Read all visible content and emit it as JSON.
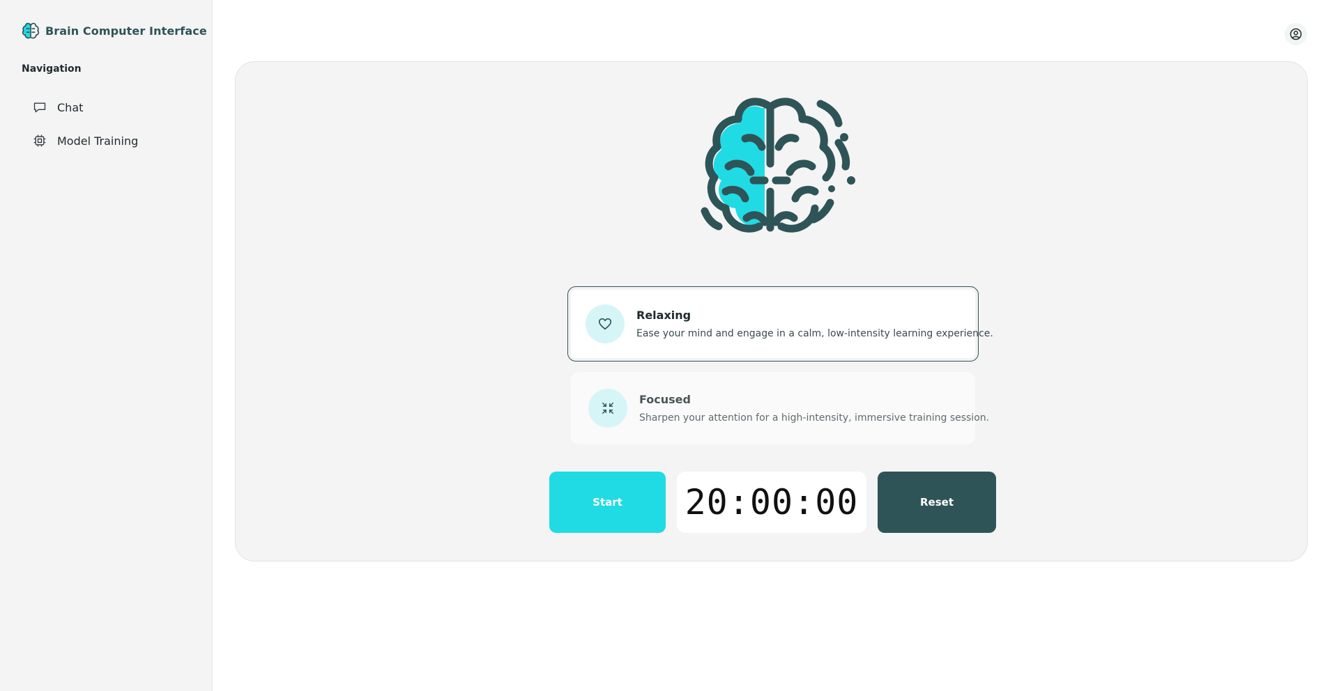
{
  "app": {
    "title": "Brain Computer Interface",
    "logo_icon": "brain-icon"
  },
  "sidebar": {
    "heading": "Navigation",
    "items": [
      {
        "label": "Chat",
        "icon": "chat-bubble-icon"
      },
      {
        "label": "Model Training",
        "icon": "cpu-chip-icon"
      }
    ]
  },
  "header": {
    "user_icon": "user-circle-icon"
  },
  "main": {
    "hero_icon": "brain-icon",
    "modes": [
      {
        "title": "Relaxing",
        "description": "Ease your mind and engage in a calm, low-intensity learning experience.",
        "icon": "heart-icon",
        "selected": true
      },
      {
        "title": "Focused",
        "description": "Sharpen your attention for a high-intensity, immersive training session.",
        "icon": "minimize-arrows-icon",
        "selected": false
      }
    ],
    "controls": {
      "start_label": "Start",
      "timer": "20:00:00",
      "reset_label": "Reset"
    }
  },
  "colors": {
    "accent": "#20dbe4",
    "brand_dark": "#2e5457",
    "icon_bg": "#d6f5f7",
    "panel_bg": "#f4f4f4"
  }
}
